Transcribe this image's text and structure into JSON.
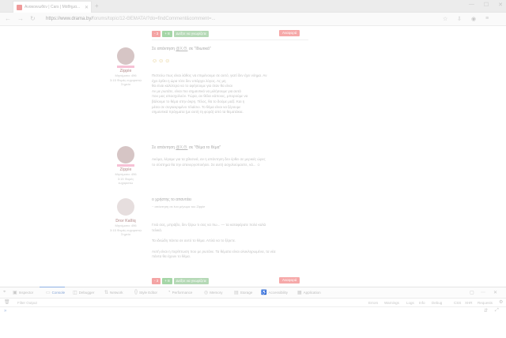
{
  "browser": {
    "tab_title": "Ανακοινωθέν | Cars | Μάθημα...",
    "url": "https://www.drama.by/",
    "url_rest": "forums/topic/12-ΘΕΜΑΤΑ/?do=findComment&comment=...",
    "icons": [
      "back-icon",
      "forward-icon",
      "reload-icon",
      "bookmark-icon",
      "download-icon",
      "account-icon",
      "menu-icon"
    ]
  },
  "votes": {
    "minus": "- 3",
    "plus": "+ 8",
    "green": "Δείξτε να γνωρίζετε",
    "green2": "Αξιολογήστε",
    "report": "Αναφορά"
  },
  "posts": [
    {
      "user": "Zippie",
      "meta": [
        "Μηνύματα: 496",
        "3:15 Φορές ευχαριστώ",
        "Σημείο"
      ],
      "header": "Σε απάντηση",
      "header_link": "@Χ.Θ.",
      "header_tail": "σε \"Ιδιωτικά\"",
      "smiles": "☺☺☺",
      "body": [
        "Πιστεύω πως είναι λάθος να επιμένουμε σε αυτό, γιατί δεν έχει νόημα. Αν",
        "έχει έρθει η ώρα τότε δεν υπάρχει λόγος. Ας μη",
        "θα είναι καλύτερα να το αφήσουμε για όταν θα είναι",
        "Αν με ρωτάτε, είναι πιο σημαντικό να μιλήσουμε για αυτά",
        "που μας απασχολούν. Τώρα, αν θέλει κάποιος, μπορούμε να",
        "βάλουμε το θέμα στην άκρη. Τέλος, θα το δούμε μαζί. Και η",
        "μέσα σε συγκεκριμένο πλαίσιο. Το θέμα είναι να ξέρουμε",
        "σημαντικά πράγματα (με αυτή τη φορά) από τα θεματάκια."
      ]
    },
    {
      "user": "Zippie",
      "meta": [
        "Μηνύματα: 496",
        "3:15 Φορές",
        "ευχαριστώ"
      ],
      "header": "Σε απάντηση",
      "header_link": "@Χ.Θ.",
      "header_tail": "σε \"Θέμα το θέμα\"",
      "body": [
        "Ακόμα, λέγαμε για τα χθεσινά, αν η απάντηση δεν έρθει σε μερικές ώρες",
        "το σύστημα θα την απενεργοποιήσει. Σε αυτή ασχολούμαστε, νά... ☺"
      ]
    },
    {
      "user": "Dror Kalliq",
      "meta": [
        "Μηνύματα: 496",
        "3:15 Φορές ευχαριστώ",
        "Σημείο"
      ],
      "quote_title": "ο χρήστης το απαντάει",
      "quote_sub": "~ απάντηση σε ένα μήνυμα του Zippie",
      "body": [
        "Γειά σας, μπράβο, δεν ξέρω τι σας να πω... — τα καταφέρατε πολύ καλά",
        "τελικά.",
        "",
        "Τα ιδεώδη πάντα σε αυτό το θέμα. Απλά να το ξέρετε.",
        "",
        "Αυτή είναι η περίπτωση που με ρωτάνε. Τα θέματα είναι ολοκληρωμένα, τα νέα",
        "πάντα θα έχουν το θέμα."
      ]
    }
  ],
  "devtools": {
    "tabs": [
      "Inspector",
      "Console",
      "Debugger",
      "Network",
      "Style Editor",
      "Performance",
      "Memory",
      "Storage",
      "Accessibility",
      "Application"
    ],
    "active_tab": "Console",
    "filter_placeholder": "Filter Output",
    "levels": [
      "Errors",
      "Warnings",
      "Logs",
      "Info",
      "Debug",
      "CSS",
      "XHR",
      "Requests"
    ],
    "prompt": "»"
  }
}
